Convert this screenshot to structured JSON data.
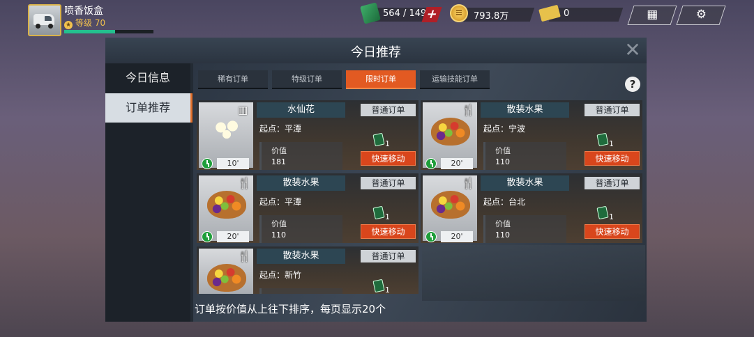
{
  "player": {
    "name": "喷香饭盒",
    "level": "等级 70",
    "xp_fraction": 0.57
  },
  "resources": {
    "fuel": "564 / 149",
    "coins": "793.8万",
    "tickets": "0"
  },
  "panel": {
    "title": "今日推荐",
    "close": "✕"
  },
  "sidebar": [
    {
      "label": "今日信息"
    },
    {
      "label": "订单推荐"
    }
  ],
  "tabs": [
    {
      "label": "稀有订单"
    },
    {
      "label": "特级订单"
    },
    {
      "label": "限时订单"
    },
    {
      "label": "运输技能订单"
    }
  ],
  "help": "?",
  "cards": [
    {
      "name": "水仙花",
      "type": "普通订单",
      "origin": "起点：平潭",
      "value_label": "价值",
      "value": "181",
      "time": "10'",
      "book_count": "1",
      "move_label": "快速移动"
    },
    {
      "name": "散装水果",
      "type": "普通订单",
      "origin": "起点：宁波",
      "value_label": "价值",
      "value": "110",
      "time": "20'",
      "book_count": "1",
      "move_label": "快速移动"
    },
    {
      "name": "散装水果",
      "type": "普通订单",
      "origin": "起点：平潭",
      "value_label": "价值",
      "value": "110",
      "time": "20'",
      "book_count": "1",
      "move_label": "快速移动"
    },
    {
      "name": "散装水果",
      "type": "普通订单",
      "origin": "起点：台北",
      "value_label": "价值",
      "value": "110",
      "time": "20'",
      "book_count": "1",
      "move_label": "快速移动"
    },
    {
      "name": "散装水果",
      "type": "普通订单",
      "origin": "起点：新竹",
      "value_label": "价值",
      "value": "",
      "time": "",
      "book_count": "1",
      "move_label": ""
    }
  ],
  "footer_note": "订单按价值从上往下排序，每页显示20个",
  "colors": {
    "accent": "#e25a22",
    "panel": "#232b34",
    "card_header": "#2d4653"
  }
}
